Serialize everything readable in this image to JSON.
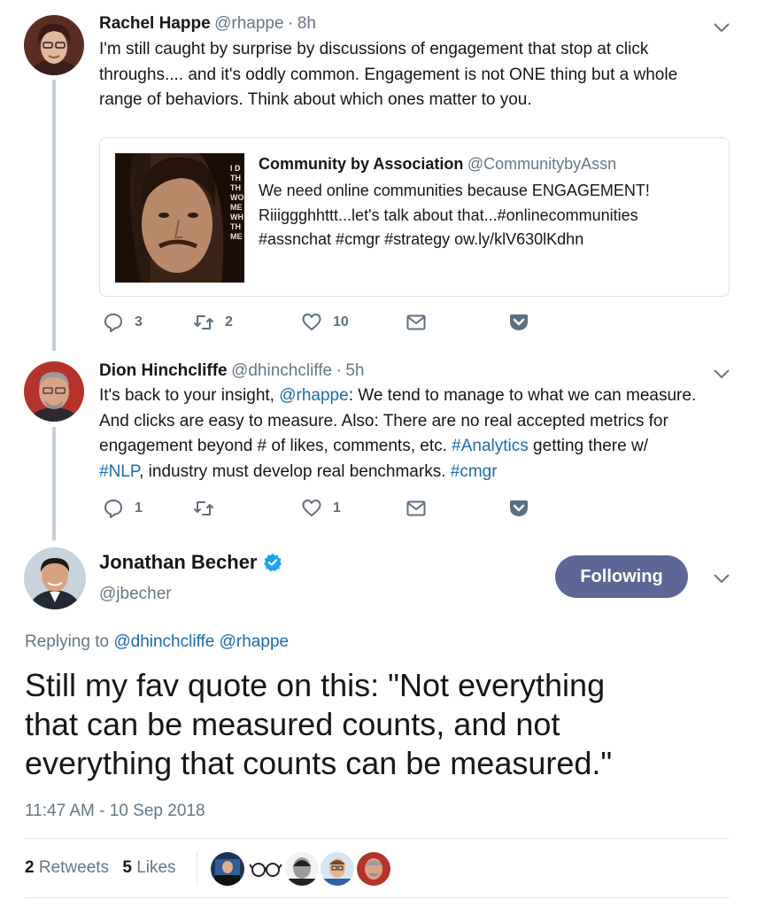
{
  "tweet1": {
    "name": "Rachel Happe",
    "handle": "@rhappe",
    "dot": "·",
    "time": "8h",
    "lines": [
      "I'm still caught by surprise by discussions of engagement that stop at click",
      "throughs.... and it's oddly common. Engagement is not ONE thing but a whole",
      "range of behaviors. Think about which ones matter to you."
    ],
    "quote": {
      "name": "Community by Association",
      "handle": "@CommunitybyAssn",
      "lines": [
        "We need online communities because ENGAGEMENT!",
        "Riiiggghhttt...let's talk about that...#onlinecommunities",
        "#assnchat #cmgr #strategy ow.ly/klV630lKdhn"
      ],
      "image_text": [
        "I D",
        "TH",
        "TH",
        "WO",
        "ME",
        "WH",
        "TH",
        "ME"
      ]
    },
    "replies": "3",
    "retweets": "2",
    "likes": "10"
  },
  "tweet2": {
    "name": "Dion Hinchcliffe",
    "handle": "@dhinchcliffe",
    "dot": "·",
    "time": "5h",
    "line1_pre": "It's back to your insight, ",
    "line1_mention": "@rhappe",
    "line1_post": ": We tend to manage to what we can measure.",
    "line2": "And clicks are easy to measure. Also: There are no real accepted metrics for",
    "line3_pre": "engagement beyond # of likes, comments, etc. ",
    "line3_tag": "#Analytics",
    "line3_post": " getting there w/",
    "line4_tag": "#NLP",
    "line4_mid": ", industry must develop real benchmarks. ",
    "line4_tag2": "#cmgr",
    "replies": "1",
    "likes": "1"
  },
  "main": {
    "name": "Jonathan Becher",
    "handle": "@jbecher",
    "follow_label": "Following",
    "replying_label": "Replying to",
    "replying_to": "@dhinchcliffe @rhappe",
    "text_lines": [
      "Still my fav quote on this: \"Not everything",
      "that can be measured counts, and not",
      "everything that counts can be measured.\""
    ],
    "timestamp": "11:47 AM - 10 Sep 2018",
    "retweet_count": "2",
    "retweet_label": "Retweets",
    "like_count": "5",
    "like_label": "Likes"
  },
  "colors": {
    "link": "#1b6ba8",
    "muted": "#657786",
    "following_button": "#5d6694",
    "verified": "#1da1f2"
  }
}
